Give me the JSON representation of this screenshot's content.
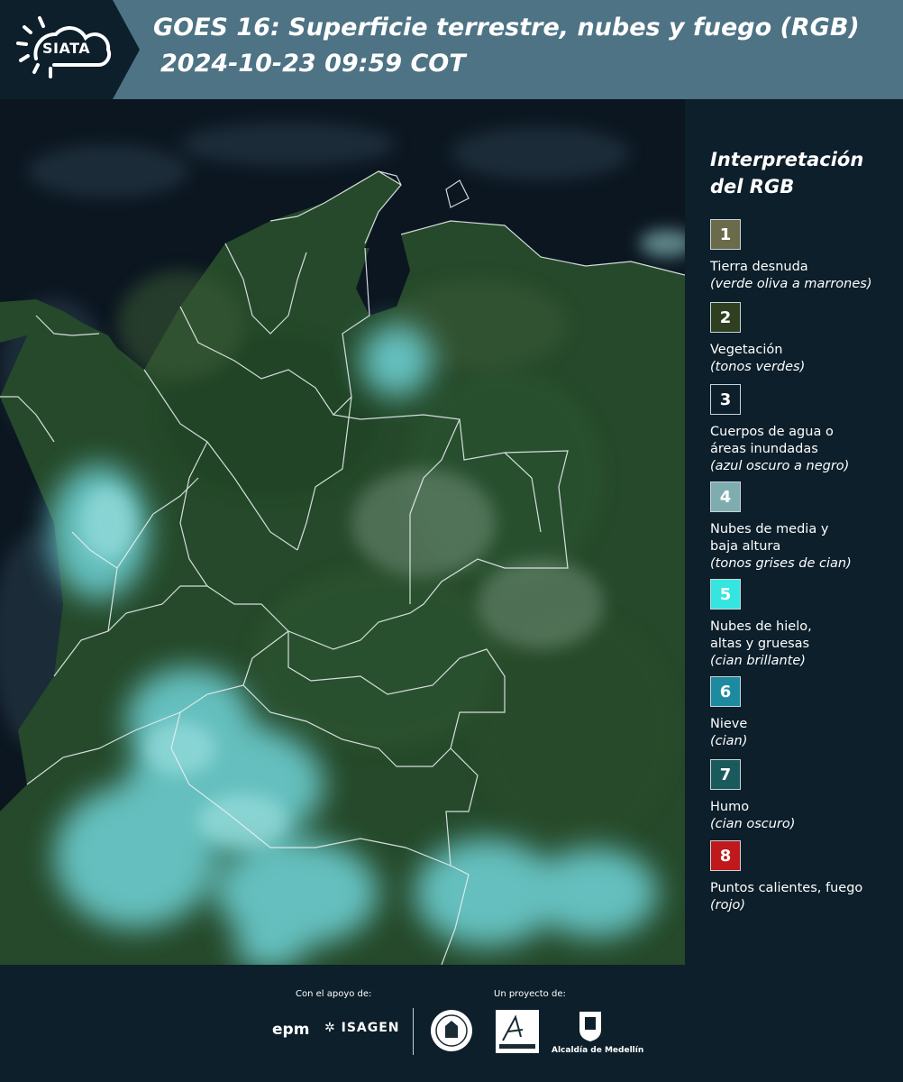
{
  "header": {
    "logo_text": "SIATA",
    "title_line1": "GOES 16: Superficie terrestre, nubes y fuego (RGB)",
    "title_line2": "2024-10-23 09:59 COT",
    "background_color": "#4d7384"
  },
  "map": {
    "description_icon": "satellite-rgb-map",
    "colors": {
      "ocean": "#0b1620",
      "vegetation": "#25492a",
      "cloud": "#6fd4d8",
      "border": "#e8eef0"
    }
  },
  "legend": {
    "title": "Interpretación del RGB",
    "items": [
      {
        "number": "1",
        "label": "Tierra desnuda",
        "desc": "(verde oliva a marrones)",
        "color": "#6b6a4a"
      },
      {
        "number": "2",
        "label": "Vegetación",
        "desc": "(tonos verdes)",
        "color": "#2e4020"
      },
      {
        "number": "3",
        "label": "Cuerpos de agua o áreas inundadas",
        "label_lines": [
          "Cuerpos de agua o",
          "áreas inundadas"
        ],
        "desc": "(azul oscuro a negro)",
        "color": "#0c1f2b"
      },
      {
        "number": "4",
        "label": "Nubes de media y baja altura",
        "label_lines": [
          "Nubes de media y",
          "baja altura"
        ],
        "desc": "(tonos grises de cian)",
        "color": "#7fadaf"
      },
      {
        "number": "5",
        "label": "Nubes de hielo, altas y gruesas",
        "label_lines": [
          "Nubes de hielo,",
          "altas y gruesas"
        ],
        "desc": "(cian brillante)",
        "color": "#35e6e0"
      },
      {
        "number": "6",
        "label": "Nieve",
        "desc": "(cian)",
        "color": "#1d8aa0"
      },
      {
        "number": "7",
        "label": "Humo",
        "desc": "(cian oscuro)",
        "color": "#1b5a5c"
      },
      {
        "number": "8",
        "label": "Puntos calientes, fuego",
        "desc": "(rojo)",
        "color": "#c0191c"
      }
    ]
  },
  "footer": {
    "support_label": "Con el apoyo de:",
    "project_label": "Un proyecto de:",
    "epm": "epm",
    "isagen": "ISAGEN",
    "area_metropolitana": "Área Metropolitana",
    "alcaldia": "Alcaldía de Medellín"
  }
}
